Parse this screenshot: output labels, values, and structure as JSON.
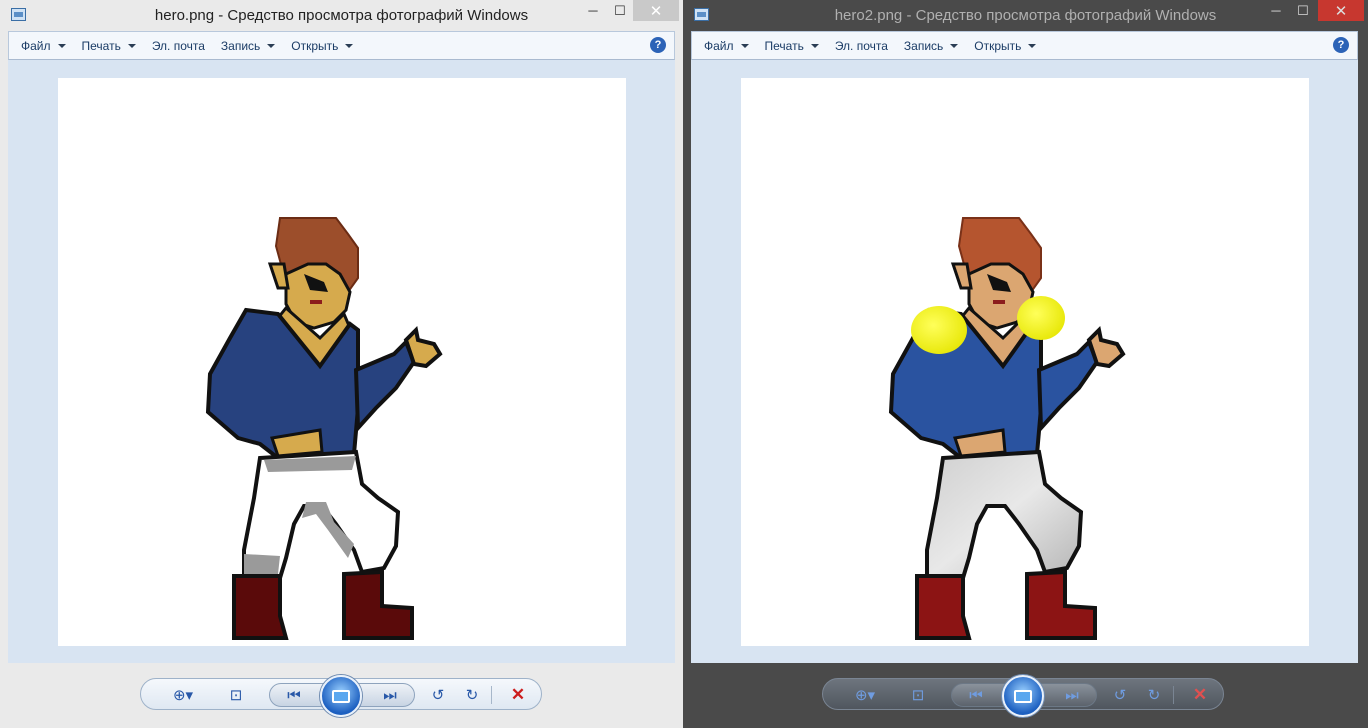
{
  "left_window": {
    "title": "hero.png - Средство просмотра фотографий Windows",
    "menu": [
      "Файл",
      "Печать",
      "Эл. почта",
      "Запись",
      "Открыть"
    ],
    "menu_has_arrow": [
      true,
      true,
      false,
      true,
      true
    ],
    "help": "?",
    "image": "hero-sprite-white-pants"
  },
  "right_window": {
    "title": "hero2.png - Средство просмотра фотографий Windows",
    "menu": [
      "Файл",
      "Печать",
      "Эл. почта",
      "Запись",
      "Открыть"
    ],
    "menu_has_arrow": [
      true,
      true,
      false,
      true,
      true
    ],
    "help": "?",
    "image": "hero-sprite-shaded-yellow-shoulders"
  },
  "window_controls": {
    "minimize": "─",
    "maximize": "☐",
    "close": "✕"
  },
  "toolbar_icons": [
    "zoom-icon",
    "fit-window-icon",
    "previous-icon",
    "slideshow-icon",
    "next-icon",
    "rotate-ccw-icon",
    "rotate-cw-icon",
    "delete-icon"
  ],
  "colors": {
    "shirt": "#27427f",
    "skin": "#d6aa4d",
    "hair": "#9c4e2b",
    "boots": "#5a0a0a",
    "shoulder_pads": "#ffff00"
  }
}
